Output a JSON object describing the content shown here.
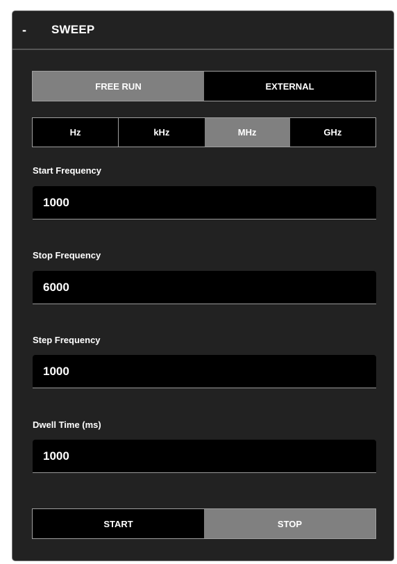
{
  "panel": {
    "collapse_symbol": "-",
    "title": "SWEEP"
  },
  "trigger_mode": {
    "options": [
      "FREE RUN",
      "EXTERNAL"
    ],
    "selected": "FREE RUN"
  },
  "units": {
    "options": [
      "Hz",
      "kHz",
      "MHz",
      "GHz"
    ],
    "selected": "MHz"
  },
  "fields": {
    "start_frequency": {
      "label": "Start Frequency",
      "value": "1000"
    },
    "stop_frequency": {
      "label": "Stop Frequency",
      "value": "6000"
    },
    "step_frequency": {
      "label": "Step Frequency",
      "value": "1000"
    },
    "dwell_time": {
      "label": "Dwell Time (ms)",
      "value": "1000"
    }
  },
  "controls": {
    "start_label": "START",
    "stop_label": "STOP",
    "active": "STOP"
  },
  "colors": {
    "panel_bg": "#222222",
    "active_button": "#808080",
    "inactive_button": "#000000",
    "text": "#ffffff"
  }
}
